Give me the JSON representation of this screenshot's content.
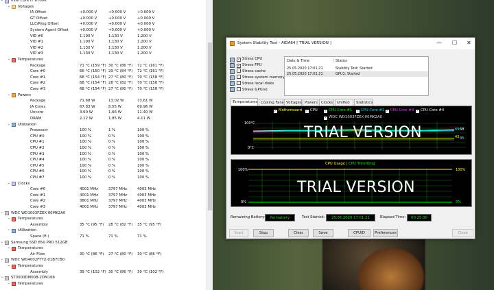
{
  "sensor_tree": {
    "rows": [
      {
        "indent": 1,
        "icon": "chip-icon",
        "label": "Intel Core i7 6700K",
        "v1": "",
        "v2": "",
        "v3": "",
        "head": true
      },
      {
        "indent": 2,
        "icon": "voltage-icon",
        "label": "Voltages",
        "v1": "",
        "v2": "",
        "v3": "",
        "head": true
      },
      {
        "indent": 3,
        "icon": "",
        "label": "IA Offset",
        "v1": "+0.000 V",
        "v2": "+0.000 V",
        "v3": "+0.000 V"
      },
      {
        "indent": 3,
        "icon": "",
        "label": "GT Offset",
        "v1": "+0.000 V",
        "v2": "+0.000 V",
        "v3": "+0.000 V"
      },
      {
        "indent": 3,
        "icon": "",
        "label": "LLC/Ring Offset",
        "v1": "+0.000 V",
        "v2": "+0.000 V",
        "v3": "+0.000 V"
      },
      {
        "indent": 3,
        "icon": "",
        "label": "System Agent Offset",
        "v1": "+0.000 V",
        "v2": "+0.000 V",
        "v3": "+0.000 V"
      },
      {
        "indent": 3,
        "icon": "",
        "label": "VID #0",
        "v1": "1.190 V",
        "v2": "1.130 V",
        "v3": "1.200 V"
      },
      {
        "indent": 3,
        "icon": "",
        "label": "VID #1",
        "v1": "1.190 V",
        "v2": "1.130 V",
        "v3": "1.200 V"
      },
      {
        "indent": 3,
        "icon": "",
        "label": "VID #2",
        "v1": "1.130 V",
        "v2": "1.130 V",
        "v3": "1.200 V"
      },
      {
        "indent": 3,
        "icon": "",
        "label": "VID #3",
        "v1": "1.130 V",
        "v2": "1.130 V",
        "v3": "1.200 V"
      },
      {
        "indent": 2,
        "icon": "temperature-icon",
        "label": "Temperatures",
        "v1": "",
        "v2": "",
        "v3": "",
        "head": true
      },
      {
        "indent": 3,
        "icon": "",
        "label": "Package",
        "v1": "71 °C  (159 °F)",
        "v2": "30 °C  (86 °F)",
        "v3": "72 °C  (161 °F)"
      },
      {
        "indent": 3,
        "icon": "",
        "label": "Core #0",
        "v1": "66 °C  (150 °F)",
        "v2": "29 °C  (84 °F)",
        "v3": "72 °C  (161 °F)"
      },
      {
        "indent": 3,
        "icon": "",
        "label": "Core #1",
        "v1": "68 °C  (154 °F)",
        "v2": "27 °C  (80 °F)",
        "v3": "70 °C  (158 °F)"
      },
      {
        "indent": 3,
        "icon": "",
        "label": "Core #2",
        "v1": "68 °C  (154 °F)",
        "v2": "28 °C  (82 °F)",
        "v3": "70 °C  (158 °F)"
      },
      {
        "indent": 3,
        "icon": "",
        "label": "Core #3",
        "v1": "68 °C  (154 °F)",
        "v2": "27 °C  (80 °F)",
        "v3": "70 °C  (158 °F)"
      },
      {
        "indent": 2,
        "icon": "power-icon",
        "label": "Powers",
        "v1": "",
        "v2": "",
        "v3": "",
        "head": true
      },
      {
        "indent": 3,
        "icon": "",
        "label": "Package",
        "v1": "71.68 W",
        "v2": "13.02 W",
        "v3": "73.61 W"
      },
      {
        "indent": 3,
        "icon": "",
        "label": "IA Cores",
        "v1": "67.83 W",
        "v2": "8.55 W",
        "v3": "69.96 W"
      },
      {
        "indent": 3,
        "icon": "",
        "label": "Uncore",
        "v1": "3.60 W",
        "v2": "1.66 W",
        "v3": "11.40 W"
      },
      {
        "indent": 3,
        "icon": "",
        "label": "DRAM",
        "v1": "2.12 W",
        "v2": "1.85 W",
        "v3": "4.11 W"
      },
      {
        "indent": 2,
        "icon": "utilization-icon",
        "label": "Utilization",
        "v1": "",
        "v2": "",
        "v3": "",
        "head": true
      },
      {
        "indent": 3,
        "icon": "",
        "label": "Processor",
        "v1": "100 %",
        "v2": "1 %",
        "v3": "100 %"
      },
      {
        "indent": 3,
        "icon": "",
        "label": "CPU #0",
        "v1": "100 %",
        "v2": "0 %",
        "v3": "100 %"
      },
      {
        "indent": 3,
        "icon": "",
        "label": "CPU #1",
        "v1": "100 %",
        "v2": "0 %",
        "v3": "100 %"
      },
      {
        "indent": 3,
        "icon": "",
        "label": "CPU #2",
        "v1": "100 %",
        "v2": "0 %",
        "v3": "100 %"
      },
      {
        "indent": 3,
        "icon": "",
        "label": "CPU #3",
        "v1": "100 %",
        "v2": "0 %",
        "v3": "100 %"
      },
      {
        "indent": 3,
        "icon": "",
        "label": "CPU #4",
        "v1": "100 %",
        "v2": "0 %",
        "v3": "100 %"
      },
      {
        "indent": 3,
        "icon": "",
        "label": "CPU #5",
        "v1": "100 %",
        "v2": "0 %",
        "v3": "100 %"
      },
      {
        "indent": 3,
        "icon": "",
        "label": "CPU #6",
        "v1": "100 %",
        "v2": "0 %",
        "v3": "100 %"
      },
      {
        "indent": 3,
        "icon": "",
        "label": "CPU #7",
        "v1": "100 %",
        "v2": "0 %",
        "v3": "100 %"
      },
      {
        "indent": 2,
        "icon": "clock-icon",
        "label": "Clocks",
        "v1": "",
        "v2": "",
        "v3": "",
        "head": true
      },
      {
        "indent": 3,
        "icon": "",
        "label": "Core #0",
        "v1": "4001 MHz",
        "v2": "3797 MHz",
        "v3": "4003 MHz"
      },
      {
        "indent": 3,
        "icon": "",
        "label": "Core #1",
        "v1": "4001 MHz",
        "v2": "3797 MHz",
        "v3": "4003 MHz"
      },
      {
        "indent": 3,
        "icon": "",
        "label": "Core #2",
        "v1": "3801 MHz",
        "v2": "3797 MHz",
        "v3": "4003 MHz"
      },
      {
        "indent": 3,
        "icon": "",
        "label": "Core #3",
        "v1": "4001 MHz",
        "v2": "3797 MHz",
        "v3": "4003 MHz"
      },
      {
        "indent": 1,
        "icon": "disk-icon",
        "label": "WDC WD1003FZEX-00MK2A0",
        "v1": "",
        "v2": "",
        "v3": "",
        "head": true
      },
      {
        "indent": 2,
        "icon": "temperature-icon",
        "label": "Temperatures",
        "v1": "",
        "v2": "",
        "v3": "",
        "head": true
      },
      {
        "indent": 3,
        "icon": "",
        "label": "Assembly",
        "v1": "35 °C  (95 °F)",
        "v2": "28 °C  (82 °F)",
        "v3": "35 °C  (95 °F)"
      },
      {
        "indent": 2,
        "icon": "utilization-icon",
        "label": "Utilization",
        "v1": "",
        "v2": "",
        "v3": "",
        "head": true
      },
      {
        "indent": 3,
        "icon": "",
        "label": "Space (E:)",
        "v1": "71 %",
        "v2": "71 %",
        "v3": "71 %"
      },
      {
        "indent": 1,
        "icon": "disk-icon",
        "label": "Samsung SSD 850 PRO 512GB",
        "v1": "",
        "v2": "",
        "v3": "",
        "head": true
      },
      {
        "indent": 2,
        "icon": "temperature-icon",
        "label": "Temperatures",
        "v1": "",
        "v2": "",
        "v3": "",
        "head": true
      },
      {
        "indent": 3,
        "icon": "",
        "label": "Air Flow",
        "v1": "30 °C  (86 °F)",
        "v2": "27 °C  (80 °F)",
        "v3": "30 °C  (86 °F)"
      },
      {
        "indent": 1,
        "icon": "disk-icon",
        "label": "WDC WD4002FYYZ-01B7CB0",
        "v1": "",
        "v2": "",
        "v3": "",
        "head": true
      },
      {
        "indent": 2,
        "icon": "temperature-icon",
        "label": "Temperatures",
        "v1": "",
        "v2": "",
        "v3": "",
        "head": true
      },
      {
        "indent": 3,
        "icon": "",
        "label": "Assembly",
        "v1": "39 °C  (102 °F)",
        "v2": "30 °C  (86 °F)",
        "v3": "39 °C  (102 °F)"
      },
      {
        "indent": 1,
        "icon": "disk-icon",
        "label": "ST3000DM008-2DM166",
        "v1": "",
        "v2": "",
        "v3": "",
        "head": true
      },
      {
        "indent": 2,
        "icon": "temperature-icon",
        "label": "Temperatures",
        "v1": "",
        "v2": "",
        "v3": "",
        "head": true
      }
    ]
  },
  "dialog": {
    "title": "System Stability Test - AIDA64  [ TRIAL VERSION ]",
    "minimize_glyph": "—",
    "maximize_glyph": "☐",
    "close_glyph": "✕",
    "checks": [
      {
        "label": "Stress CPU",
        "checked": true
      },
      {
        "label": "Stress FPU",
        "checked": true
      },
      {
        "label": "Stress cache",
        "checked": false
      },
      {
        "label": "Stress system memory",
        "checked": false
      },
      {
        "label": "Stress local disks",
        "checked": false
      },
      {
        "label": "Stress GPU(s)",
        "checked": false
      }
    ],
    "log_headers": {
      "date": "Date & Time",
      "status": "Status"
    },
    "log_rows": [
      {
        "date": "25.05.2020 17:01:21",
        "status": "Stability Test: Started"
      },
      {
        "date": "25.05.2020 17:01:21",
        "status": "GPU1: Started"
      }
    ],
    "tabs": [
      "Temperatures",
      "Cooling Fans",
      "Voltages",
      "Powers",
      "Clocks",
      "Unified",
      "Statistics"
    ],
    "temp_legend": [
      {
        "label": "Motherboard",
        "color": "#ffff00"
      },
      {
        "label": "CPU",
        "color": "#ffffff"
      },
      {
        "label": "CPU Core #1",
        "color": "#00ff00"
      },
      {
        "label": "CPU Core #2",
        "color": "#00e5ff"
      },
      {
        "label": "CPU Core #3",
        "color": "#ff40ff"
      },
      {
        "label": "CPU Core #4",
        "color": "#ffffff"
      }
    ],
    "temp_legend2": "WDC WD1003FZEX-00MK2A0",
    "temp_top": "100°C",
    "temp_bottom": "0°C",
    "temp_values": {
      "a": "69",
      "b": "68",
      "c": "43",
      "d": "35"
    },
    "trial_text": "TRIAL VERSION",
    "usage_title": "CPU Usage",
    "usage_sep": "|",
    "throttle_title": "CPU Throttling",
    "usage_top_left": "100%",
    "usage_bottom_left": "0%",
    "usage_top_right": "100%",
    "usage_bottom_right": "0%",
    "battery_label": "Remaining Battery:",
    "battery_value": "No battery",
    "started_label": "Test Started:",
    "started_value": "25.05.2020 17:01:21",
    "elapsed_label": "Elapsed Time:",
    "elapsed_value": "00:25:30",
    "buttons": [
      "Start",
      "Stop",
      "Clear",
      "Save",
      "CPUID",
      "Preferences",
      "Close"
    ]
  }
}
